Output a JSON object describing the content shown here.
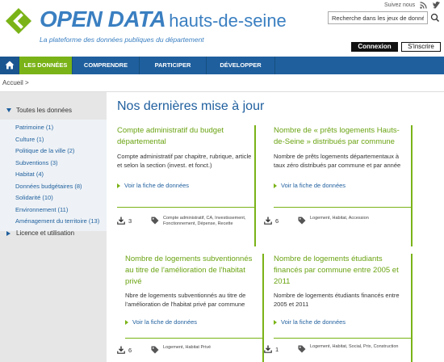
{
  "header": {
    "brand_open": "OPEN DATA",
    "brand_place": "hauts-de-seine",
    "tagline": "La plateforme des données publiques du département",
    "follow_label": "Suivez nous",
    "follow_icons": [
      "rss-icon",
      "twitter-icon"
    ],
    "search_value": "Recherche dans les jeux de données",
    "login_label": "Connexion",
    "signup_label": "S'inscrire",
    "colors": {
      "brand": "#3a7fc1",
      "green": "#7ab317",
      "nav": "#1f5f9e"
    }
  },
  "nav": {
    "home_icon": "home-icon",
    "items": [
      {
        "label": "LES DONNÉES",
        "active": true
      },
      {
        "label": "COMPRENDRE",
        "active": false
      },
      {
        "label": "PARTICIPER",
        "active": false
      },
      {
        "label": "DÉVELOPPER",
        "active": false
      }
    ]
  },
  "breadcrumb": "Accueil >",
  "sidebar": {
    "heading": "Toutes les données",
    "items": [
      "Patrimoine (1)",
      "Culture (1)",
      "Politique de la ville (2)",
      "Subventions (3)",
      "Habitat (4)",
      "Données budgétaires (8)",
      "Solidarité (10)",
      "Environnement (11)",
      "Aménagement du territoire (13)"
    ],
    "footer": "Licence et utilisation"
  },
  "main": {
    "title": "Nos dernières mise à jour",
    "cards": [
      {
        "title": "Compte administratif du budget départemental",
        "desc": "Compte administratif par chapitre, rubrique, article et selon la section (invest. et fonct.)",
        "link": "Voir la fiche de données",
        "downloads": "3",
        "tags": "Compte administratif, CA, Investissement, Fonctionnement, Dépense, Recette"
      },
      {
        "title": "Nombre de « prêts logements Hauts-de-Seine » distribués par commune",
        "desc": "Nombre de prêts logements départementaux à taux zéro distribués par commune et par année",
        "link": "Voir la fiche de données",
        "downloads": "6",
        "tags": "Logement, Habitat, Accession"
      },
      {
        "title": "Nombre de logements subventionnés au titre de l'amélioration de l'habitat privé",
        "desc": "Nbre de logements subventionnés au titre de l'amélioration de l'habitat privé par commune",
        "link": "Voir la fiche de données",
        "downloads": "6",
        "tags": "Logement, Habitat Privé"
      },
      {
        "title": "Nombre de logements étudiants financés par commune entre 2005 et 2011",
        "desc": "Nombre de logements étudiants financés entre 2005 et 2011",
        "link": "Voir la fiche de données",
        "downloads": "1",
        "tags": "Logement, Habitat, Social, Prix, Construction"
      }
    ]
  }
}
